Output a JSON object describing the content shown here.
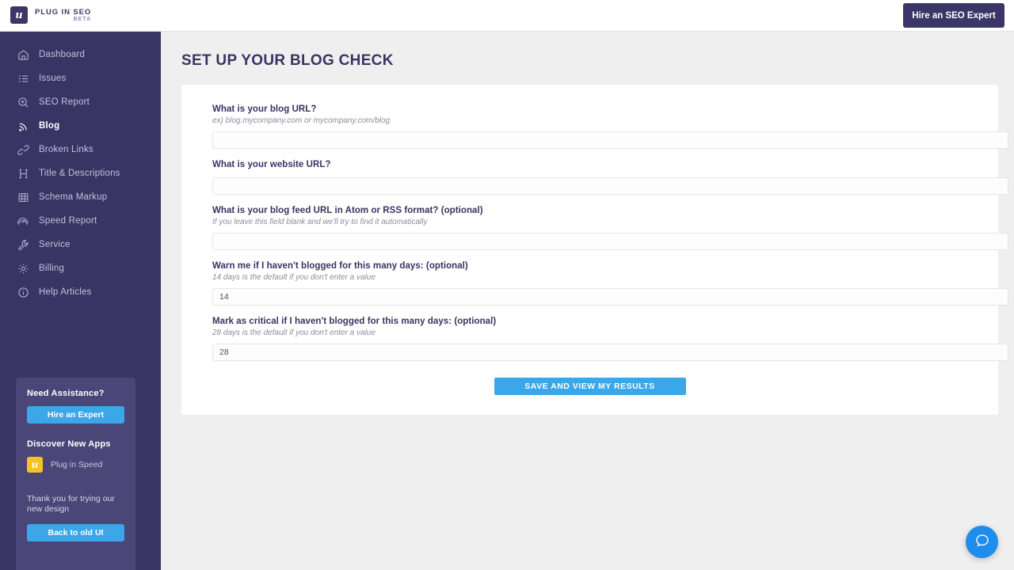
{
  "topbar": {
    "brand_name": "PLUG IN SEO",
    "brand_beta": "BETA",
    "brand_mark_glyph": "u",
    "hire_button": "Hire an SEO Expert"
  },
  "sidebar": {
    "items": [
      {
        "label": "Dashboard",
        "icon": "home-icon",
        "active": false
      },
      {
        "label": "Issues",
        "icon": "list-icon",
        "active": false
      },
      {
        "label": "SEO Report",
        "icon": "search-plus-icon",
        "active": false
      },
      {
        "label": "Blog",
        "icon": "rss-icon",
        "active": true
      },
      {
        "label": "Broken Links",
        "icon": "link-icon",
        "active": false
      },
      {
        "label": "Title & Descriptions",
        "icon": "heading-icon",
        "active": false
      },
      {
        "label": "Schema Markup",
        "icon": "grid-icon",
        "active": false
      },
      {
        "label": "Speed Report",
        "icon": "speedometer-icon",
        "active": false
      },
      {
        "label": "Service",
        "icon": "wrench-icon",
        "active": false
      },
      {
        "label": "Billing",
        "icon": "gear-icon",
        "active": false
      },
      {
        "label": "Help Articles",
        "icon": "info-circle-icon",
        "active": false
      }
    ],
    "card": {
      "assistance_title": "Need Assistance?",
      "hire_button": "Hire an Expert",
      "discover_title": "Discover New Apps",
      "app_name": "Plug in Speed",
      "app_icon_glyph": "u",
      "thanks_text": "Thank you for trying our new design",
      "back_button": "Back to old UI"
    }
  },
  "main": {
    "page_title": "SET UP YOUR BLOG CHECK",
    "fields": [
      {
        "label": "What is your blog URL?",
        "hint": "ex) blog.mycompany.com or mycompany.com/blog",
        "value": "",
        "placeholder": ""
      },
      {
        "label": "What is your website URL?",
        "hint": "",
        "value": "",
        "placeholder": ""
      },
      {
        "label": "What is your blog feed URL in Atom or RSS format? (optional)",
        "hint": "If you leave this field blank and we'll try to find it automatically",
        "value": "",
        "placeholder": ""
      },
      {
        "label": "Warn me if I haven't blogged for this many days: (optional)",
        "hint": "14 days is the default if you don't enter a value",
        "value": "14",
        "placeholder": ""
      },
      {
        "label": "Mark as critical if I haven't blogged for this many days: (optional)",
        "hint": "28 days is the default if you don't enter a value",
        "value": "28",
        "placeholder": ""
      }
    ],
    "submit_button": "Save and view my results"
  },
  "chat": {
    "icon": "chat-bubble-icon"
  },
  "colors": {
    "sidebar": "#383564",
    "sidebar_card": "#4a4677",
    "navy": "#3b3667",
    "accent_blue": "#3ba7e8",
    "chat_blue": "#1f8ded",
    "app_yellow": "#f5c328",
    "page_bg": "#efefef"
  }
}
